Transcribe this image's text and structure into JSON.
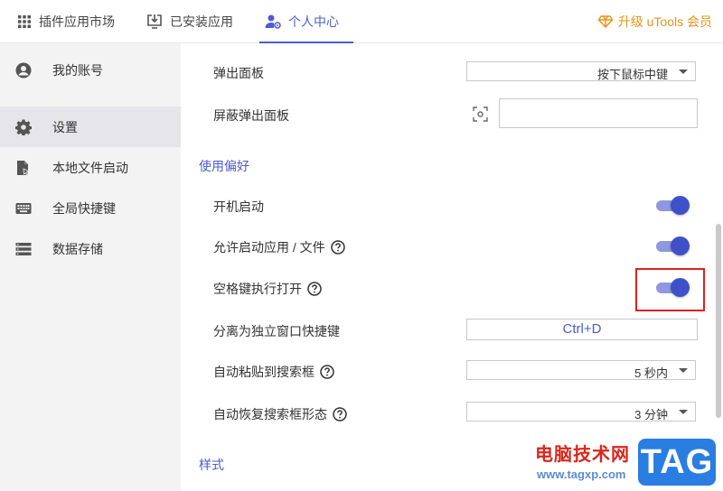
{
  "tabs": [
    {
      "label": "插件应用市场",
      "icon": "grid-icon"
    },
    {
      "label": "已安装应用",
      "icon": "installed-monitor-icon"
    },
    {
      "label": "个人中心",
      "icon": "user-settings-icon",
      "active": true
    }
  ],
  "upgrade": {
    "label": "升级 uTools 会员",
    "icon": "diamond-icon",
    "color": "#e8941a"
  },
  "sidebar": {
    "items": [
      {
        "label": "我的账号",
        "icon": "account-icon"
      },
      {
        "label": "设置",
        "icon": "gear-icon",
        "active": true
      },
      {
        "label": "本地文件启动",
        "icon": "file-launch-icon"
      },
      {
        "label": "全局快捷键",
        "icon": "keyboard-icon"
      },
      {
        "label": "数据存储",
        "icon": "storage-icon"
      }
    ]
  },
  "settings": {
    "popup_panel": {
      "label": "弹出面板",
      "value": "按下鼠标中键"
    },
    "block_popup": {
      "label": "屏蔽弹出面板",
      "value": "",
      "icon": "screenshot-target-icon"
    },
    "preferences_title": "使用偏好",
    "autostart": {
      "label": "开机启动",
      "enabled": true
    },
    "allow_launch": {
      "label": "允许启动应用 / 文件",
      "enabled": true
    },
    "space_open": {
      "label": "空格键执行打开",
      "enabled": true
    },
    "detach_hotkey": {
      "label": "分离为独立窗口快捷键",
      "value": "Ctrl+D"
    },
    "auto_paste": {
      "label": "自动粘贴到搜索框",
      "value": "5 秒内"
    },
    "auto_restore": {
      "label": "自动恢复搜索框形态",
      "value": "3 分钟"
    },
    "style_title": "样式"
  },
  "colors": {
    "accent": "#4d5ad1",
    "toggle_on": "#3f51c8",
    "highlight": "#e02020"
  },
  "watermark": {
    "text": "电脑技术网",
    "url": "www.tagxp.com",
    "tag": "TAG"
  }
}
